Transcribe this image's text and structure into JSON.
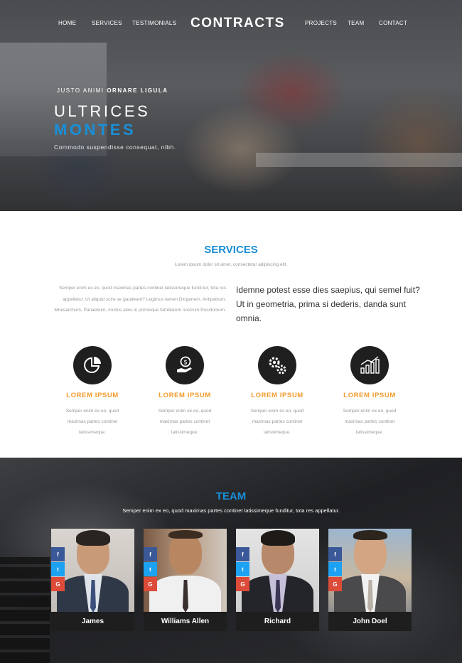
{
  "nav": {
    "brand": "CONTRACTS",
    "left": [
      "HOME",
      "SERVICES",
      "TESTIMONIALS"
    ],
    "right": [
      "PROJECTS",
      "TEAM",
      "CONTACT"
    ]
  },
  "hero": {
    "kicker_normal": "JUSTO ANIMI",
    "kicker_bold": "ORNARE LIGULA",
    "title_line1": "ULTRICES",
    "title_line2": "MONTES",
    "subtitle": "Commodo suspendisse consequat, nibh."
  },
  "services": {
    "title": "SERVICES",
    "subtitle": "Lorem ipsum dolor sit amet, consectetur adipiscing elit.",
    "left_text": "Semper enim ex eo, quod maximas partes continet latissimeque fundi tur, tota res appellatur. Ut aliquid scire se gaudeant? Legimus tamen Diogenem, Antipatrum, Mnesarchum, Panaetium, multos alios in primisque familiarem nostrum Posidonium.",
    "right_text": "Idemne potest esse dies saepius, qui semel fuit? Ut in geometria, prima si dederis, danda sunt omnia.",
    "items": [
      {
        "icon": "pie-chart-icon",
        "title": "LOREM IPSUM",
        "desc": "Semper enim ex eo, quod maximas partes continet latissimeque."
      },
      {
        "icon": "hand-money-icon",
        "title": "LOREM IPSUM",
        "desc": "Semper enim ex eo, quod maximas partes continet latissimeque."
      },
      {
        "icon": "gears-icon",
        "title": "LOREM IPSUM",
        "desc": "Semper enim ex eo, quod maximas partes continet latissimeque."
      },
      {
        "icon": "bar-chart-icon",
        "title": "LOREM IPSUM",
        "desc": "Semper enim ex eo, quod maximas partes continet latissimeque."
      }
    ]
  },
  "team": {
    "title": "TEAM",
    "subtitle": "Semper enim ex eo, quod maximas partes continet latissimeque funditur, tota res appellatur.",
    "social": {
      "facebook": "f",
      "twitter": "t",
      "google": "G"
    },
    "members": [
      {
        "name": "James"
      },
      {
        "name": "Williams Allen"
      },
      {
        "name": "Richard"
      },
      {
        "name": "John Doel"
      }
    ]
  },
  "colors": {
    "accent_blue": "#1a8fd8",
    "accent_orange": "#f39a2d",
    "facebook": "#3b5998",
    "twitter": "#1da1f2",
    "google": "#dd4b39"
  }
}
